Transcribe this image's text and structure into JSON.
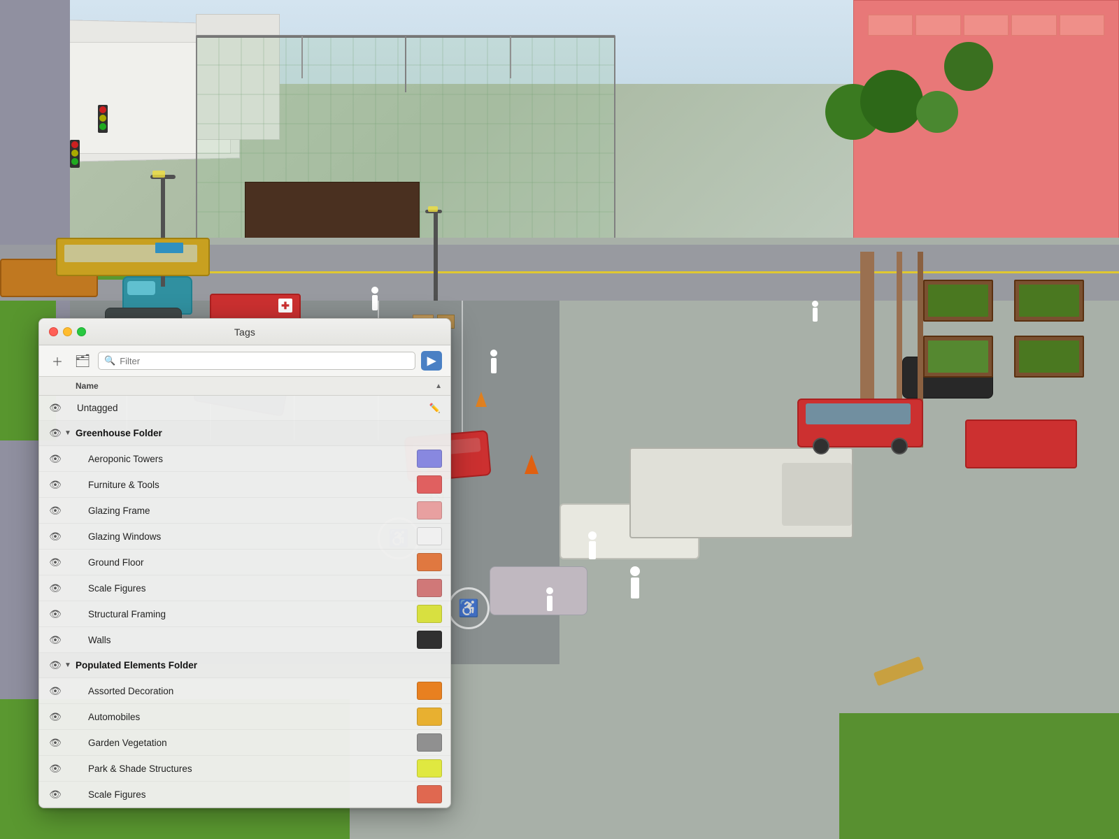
{
  "panel": {
    "title": "Tags",
    "filter_placeholder": "Filter",
    "column_name": "Name",
    "traffic_lights": [
      "close",
      "minimize",
      "maximize"
    ],
    "add_icon": "+",
    "folder_add_icon": "⊞",
    "export_icon": "↗"
  },
  "layers": [
    {
      "id": "untagged",
      "name": "Untagged",
      "level": 0,
      "type": "item",
      "has_edit": true,
      "color": null
    },
    {
      "id": "greenhouse-folder",
      "name": "Greenhouse Folder",
      "level": 0,
      "type": "folder",
      "expanded": true,
      "color": null
    },
    {
      "id": "aeroponic-towers",
      "name": "Aeroponic Towers",
      "level": 1,
      "type": "item",
      "color": "#8888e0",
      "color_display": "blue-purple"
    },
    {
      "id": "furniture-tools",
      "name": "Furniture & Tools",
      "level": 1,
      "type": "item",
      "color": "#e06060",
      "color_display": "red"
    },
    {
      "id": "glazing-frame",
      "name": "Glazing Frame",
      "level": 1,
      "type": "item",
      "color": "#e8a0a0",
      "color_display": "light-red"
    },
    {
      "id": "glazing-windows",
      "name": "Glazing Windows",
      "level": 1,
      "type": "item",
      "color": "#f0f0f0",
      "color_display": "white-gray"
    },
    {
      "id": "ground-floor",
      "name": "Ground Floor",
      "level": 1,
      "type": "item",
      "color": "#e07840",
      "color_display": "orange"
    },
    {
      "id": "scale-figures-gh",
      "name": "Scale Figures",
      "level": 1,
      "type": "item",
      "color": "#d07878",
      "color_display": "pink-red"
    },
    {
      "id": "structural-framing",
      "name": "Structural Framing",
      "level": 1,
      "type": "item",
      "color": "#d8e040",
      "color_display": "yellow-green"
    },
    {
      "id": "walls",
      "name": "Walls",
      "level": 1,
      "type": "item",
      "color": "#303030",
      "color_display": "dark"
    },
    {
      "id": "populated-elements-folder",
      "name": "Populated Elements Folder",
      "level": 0,
      "type": "folder",
      "expanded": true,
      "color": null
    },
    {
      "id": "assorted-decoration",
      "name": "Assorted Decoration",
      "level": 1,
      "type": "item",
      "color": "#e88020",
      "color_display": "orange"
    },
    {
      "id": "automobiles",
      "name": "Automobiles",
      "level": 1,
      "type": "item",
      "color": "#e8b030",
      "color_display": "yellow-orange"
    },
    {
      "id": "garden-vegetation",
      "name": "Garden Vegetation",
      "level": 1,
      "type": "item",
      "color": "#909090",
      "color_display": "gray"
    },
    {
      "id": "park-shade-structures",
      "name": "Park & Shade Structures",
      "level": 1,
      "type": "item",
      "color": "#e0e840",
      "color_display": "yellow"
    },
    {
      "id": "scale-figures-pe",
      "name": "Scale Figures",
      "level": 1,
      "type": "item",
      "color": "#e06850",
      "color_display": "red-orange"
    }
  ]
}
